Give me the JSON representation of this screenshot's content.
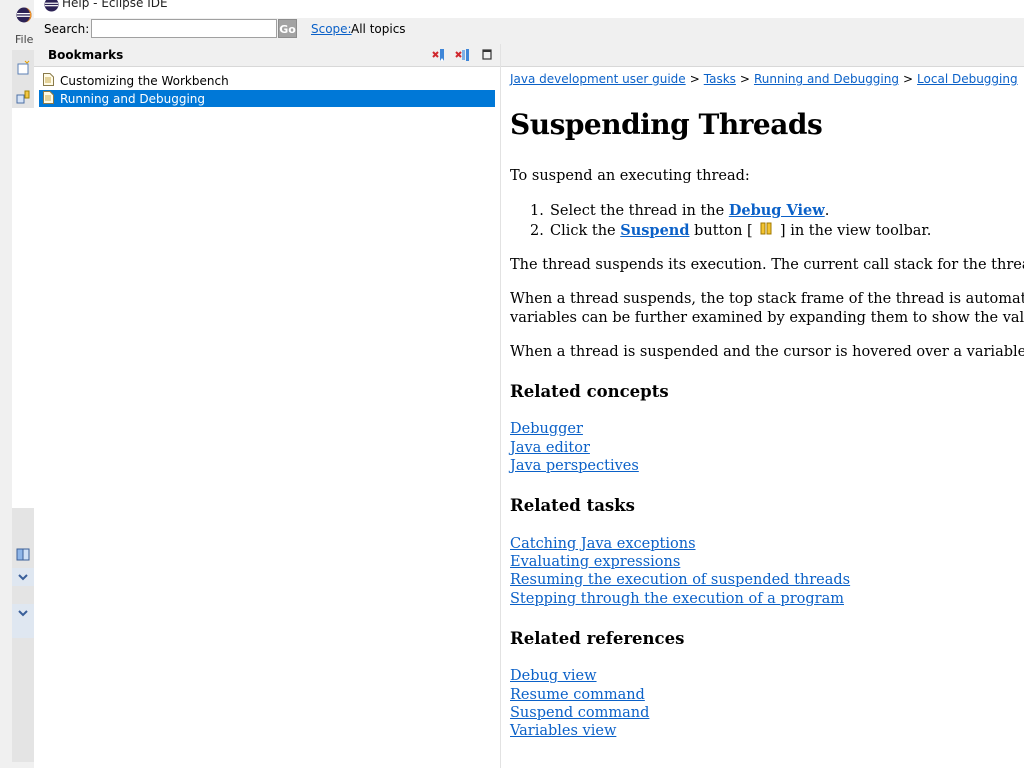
{
  "background_window": {
    "menu_file": "File"
  },
  "window": {
    "title": "Help - Eclipse IDE"
  },
  "search": {
    "label": "Search:",
    "value": "",
    "go_label": "Go",
    "scope_label": "Scope:",
    "scope_value": "All topics"
  },
  "bookmarks": {
    "title": "Bookmarks",
    "items": [
      {
        "label": "Customizing the Workbench",
        "selected": false
      },
      {
        "label": "Running and Debugging",
        "selected": true
      }
    ]
  },
  "breadcrumb": {
    "items": [
      "Java development user guide",
      "Tasks",
      "Running and Debugging",
      "Local Debugging"
    ],
    "separator": ">"
  },
  "page": {
    "title": "Suspending Threads",
    "intro": "To suspend an executing thread:",
    "step1_prefix": "Select the thread in the ",
    "step1_link": "Debug View",
    "step1_suffix": ".",
    "step2_prefix": "Click the ",
    "step2_link": "Suspend",
    "step2_middle": " button [ ",
    "step2_suffix": " ] in the view toolbar.",
    "para1": "The thread suspends its execution. The current call stack for the thread is displa",
    "para2_line1": "When a thread suspends, the top stack frame of the thread is automatically selec",
    "para2_line2": "variables can be further examined by expanding them to show the values of thei",
    "para3": "When a thread is suspended and the cursor is hovered over a variable in the Java"
  },
  "related_concepts": {
    "heading": "Related concepts",
    "links": [
      "Debugger",
      "Java editor",
      "Java perspectives"
    ]
  },
  "related_tasks": {
    "heading": "Related tasks",
    "links": [
      "Catching Java exceptions",
      "Evaluating expressions",
      "Resuming the execution of suspended threads",
      "Stepping through the execution of a program"
    ]
  },
  "related_references": {
    "heading": "Related references",
    "links": [
      "Debug view",
      "Resume command",
      "Suspend command",
      "Variables view"
    ]
  },
  "colors": {
    "link": "#0b61c8",
    "selection": "#0078d7",
    "toolbar": "#f0f0f0"
  },
  "icons": {
    "window": "eclipse-logo-icon",
    "bookmark": "page-icon",
    "remove": "remove-bookmark-icon",
    "remove_all": "remove-all-bookmarks-icon",
    "maximize": "maximize-icon",
    "suspend": "suspend-icon"
  }
}
